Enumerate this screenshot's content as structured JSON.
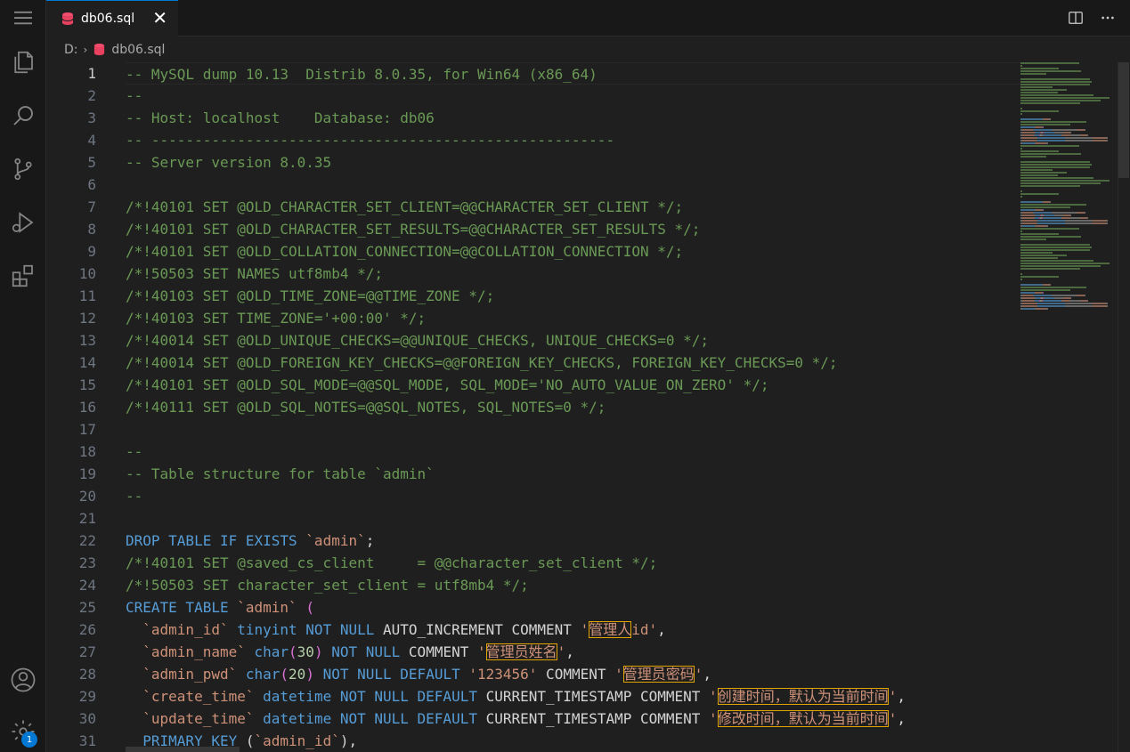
{
  "tab": {
    "title": "db06.sql",
    "close": "✕"
  },
  "breadcrumb": {
    "drive": "D:",
    "sep": "›",
    "file": "db06.sql"
  },
  "activity": {
    "account_badge": "1"
  },
  "editor": {
    "active_line": 1,
    "lines": [
      [
        [
          "c",
          "-- MySQL dump 10.13  Distrib 8.0.35, for Win64 (x86_64)"
        ]
      ],
      [
        [
          "c",
          "--"
        ]
      ],
      [
        [
          "c",
          "-- Host: localhost    Database: db06"
        ]
      ],
      [
        [
          "c",
          "-- ------------------------------------------------------"
        ]
      ],
      [
        [
          "c",
          "-- Server version 8.0.35"
        ]
      ],
      [],
      [
        [
          "c",
          "/*!40101 SET @OLD_CHARACTER_SET_CLIENT=@@CHARACTER_SET_CLIENT */;"
        ]
      ],
      [
        [
          "c",
          "/*!40101 SET @OLD_CHARACTER_SET_RESULTS=@@CHARACTER_SET_RESULTS */;"
        ]
      ],
      [
        [
          "c",
          "/*!40101 SET @OLD_COLLATION_CONNECTION=@@COLLATION_CONNECTION */;"
        ]
      ],
      [
        [
          "c",
          "/*!50503 SET NAMES utf8mb4 */;"
        ]
      ],
      [
        [
          "c",
          "/*!40103 SET @OLD_TIME_ZONE=@@TIME_ZONE */;"
        ]
      ],
      [
        [
          "c",
          "/*!40103 SET TIME_ZONE='+00:00' */;"
        ]
      ],
      [
        [
          "c",
          "/*!40014 SET @OLD_UNIQUE_CHECKS=@@UNIQUE_CHECKS, UNIQUE_CHECKS=0 */;"
        ]
      ],
      [
        [
          "c",
          "/*!40014 SET @OLD_FOREIGN_KEY_CHECKS=@@FOREIGN_KEY_CHECKS, FOREIGN_KEY_CHECKS=0 */;"
        ]
      ],
      [
        [
          "c",
          "/*!40101 SET @OLD_SQL_MODE=@@SQL_MODE, SQL_MODE='NO_AUTO_VALUE_ON_ZERO' */;"
        ]
      ],
      [
        [
          "c",
          "/*!40111 SET @OLD_SQL_NOTES=@@SQL_NOTES, SQL_NOTES=0 */;"
        ]
      ],
      [],
      [
        [
          "c",
          "--"
        ]
      ],
      [
        [
          "c",
          "-- Table structure for table `admin`"
        ]
      ],
      [
        [
          "c",
          "--"
        ]
      ],
      [],
      [
        [
          "k",
          "DROP TABLE IF EXISTS "
        ],
        [
          "s",
          "`admin`"
        ],
        [
          "i",
          ";"
        ]
      ],
      [
        [
          "c",
          "/*!40101 SET @saved_cs_client     = @@character_set_client */;"
        ]
      ],
      [
        [
          "c",
          "/*!50503 SET character_set_client = utf8mb4 */;"
        ]
      ],
      [
        [
          "k",
          "CREATE TABLE "
        ],
        [
          "s",
          "`admin`"
        ],
        [
          "i",
          " "
        ],
        [
          "p",
          "("
        ]
      ],
      [
        [
          "i",
          "  "
        ],
        [
          "s",
          "`admin_id`"
        ],
        [
          "i",
          " "
        ],
        [
          "k",
          "tinyint NOT NULL "
        ],
        [
          "i",
          "AUTO_INCREMENT COMMENT "
        ],
        [
          "s",
          "'"
        ],
        [
          "x",
          "管理人"
        ],
        [
          "s",
          "id'"
        ],
        [
          "i",
          ","
        ]
      ],
      [
        [
          "i",
          "  "
        ],
        [
          "s",
          "`admin_name`"
        ],
        [
          "i",
          " "
        ],
        [
          "k",
          "char"
        ],
        [
          "p",
          "("
        ],
        [
          "n",
          "30"
        ],
        [
          "p",
          ")"
        ],
        [
          "i",
          " "
        ],
        [
          "k",
          "NOT NULL "
        ],
        [
          "i",
          "COMMENT "
        ],
        [
          "s",
          "'"
        ],
        [
          "x",
          "管理员姓名"
        ],
        [
          "s",
          "'"
        ],
        [
          "i",
          ","
        ]
      ],
      [
        [
          "i",
          "  "
        ],
        [
          "s",
          "`admin_pwd`"
        ],
        [
          "i",
          " "
        ],
        [
          "k",
          "char"
        ],
        [
          "p",
          "("
        ],
        [
          "n",
          "20"
        ],
        [
          "p",
          ")"
        ],
        [
          "i",
          " "
        ],
        [
          "k",
          "NOT NULL DEFAULT "
        ],
        [
          "s",
          "'123456'"
        ],
        [
          "i",
          " COMMENT "
        ],
        [
          "s",
          "'"
        ],
        [
          "x",
          "管理员密码"
        ],
        [
          "s",
          "'"
        ],
        [
          "i",
          ","
        ]
      ],
      [
        [
          "i",
          "  "
        ],
        [
          "s",
          "`create_time`"
        ],
        [
          "i",
          " "
        ],
        [
          "k",
          "datetime NOT NULL DEFAULT "
        ],
        [
          "i",
          "CURRENT_TIMESTAMP COMMENT "
        ],
        [
          "s",
          "'"
        ],
        [
          "x",
          "创建时间，默认为当前时间"
        ],
        [
          "s",
          "'"
        ],
        [
          "i",
          ","
        ]
      ],
      [
        [
          "i",
          "  "
        ],
        [
          "s",
          "`update_time`"
        ],
        [
          "i",
          " "
        ],
        [
          "k",
          "datetime NOT NULL DEFAULT "
        ],
        [
          "i",
          "CURRENT_TIMESTAMP COMMENT "
        ],
        [
          "s",
          "'"
        ],
        [
          "x",
          "修改时间，默认为当前时间"
        ],
        [
          "s",
          "'"
        ],
        [
          "i",
          ","
        ]
      ],
      [
        [
          "i",
          "  "
        ],
        [
          "k",
          "PRIMARY KEY "
        ],
        [
          "i",
          "("
        ],
        [
          "s",
          "`admin_id`"
        ],
        [
          "i",
          "),"
        ]
      ]
    ]
  },
  "colors": {
    "comment": "#6a9955",
    "keyword": "#569cd6",
    "string": "#ce9178",
    "number": "#b5cea8",
    "accent": "#0078d4"
  },
  "icons": [
    "menu-icon",
    "explorer-icon",
    "search-icon",
    "source-control-icon",
    "run-debug-icon",
    "extensions-icon",
    "account-icon",
    "manage-gear-icon",
    "database-icon",
    "split-editor-icon",
    "more-actions-icon"
  ]
}
